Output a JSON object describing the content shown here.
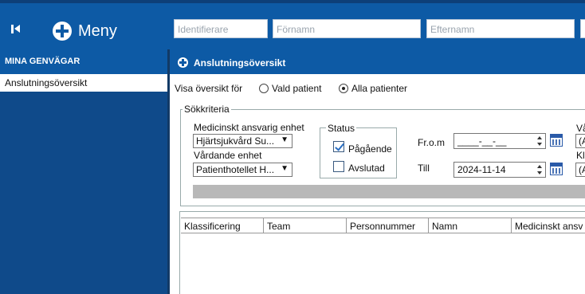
{
  "topbar": {
    "menu_label": "Meny",
    "search_fields": [
      {
        "placeholder": "Identifierare"
      },
      {
        "placeholder": "Förnamn"
      },
      {
        "placeholder": "Efternamn"
      }
    ]
  },
  "sidebar": {
    "header": "MINA GENVÄGAR",
    "items": [
      {
        "label": "Anslutningsöversikt"
      }
    ]
  },
  "panel": {
    "title": "Anslutningsöversikt",
    "overview_label": "Visa översikt för",
    "radio_options": [
      {
        "label": "Vald patient",
        "selected": false
      },
      {
        "label": "Alla patienter",
        "selected": true
      }
    ],
    "search_criteria": {
      "legend": "Sökkriteria",
      "medical_unit_label": "Medicinskt ansvarig enhet",
      "medical_unit_value": "Hjärtsjukvård Su...",
      "care_unit_label": "Vårdande enhet",
      "care_unit_value": "Patienthotellet H...",
      "status": {
        "legend": "Status",
        "options": [
          {
            "label": "Pågående",
            "checked": true
          },
          {
            "label": "Avslutad",
            "checked": false
          }
        ]
      },
      "from_label": "Fr.o.m",
      "from_value": "____-__-__",
      "to_label": "Till",
      "to_value": "2024-11-14",
      "cut_labels": [
        "Vå",
        "(A",
        "Kl",
        "(A"
      ]
    },
    "table": {
      "columns": [
        "Klassificering",
        "Team",
        "Personnummer",
        "Namn",
        "Medicinskt ansv"
      ]
    }
  },
  "colors": {
    "topbar": "#0d5aa5",
    "sidebar": "#0f4a8a",
    "header": "#0d5aa5"
  }
}
